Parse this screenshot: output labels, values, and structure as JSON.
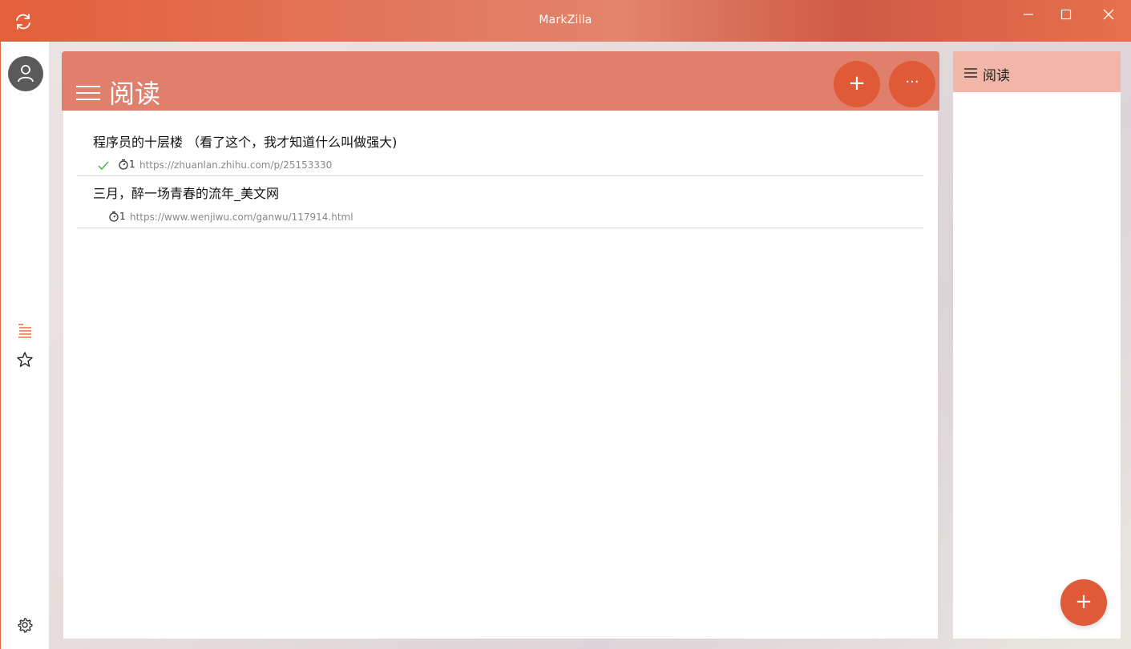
{
  "window": {
    "title": "MarkZilla"
  },
  "sidebar": {
    "items": [
      {
        "icon": "list-icon",
        "active": true
      },
      {
        "icon": "star-icon",
        "active": false
      }
    ],
    "settings_icon": "gear-icon"
  },
  "main": {
    "title": "阅读",
    "add_label": "+",
    "more_label": "···",
    "items": [
      {
        "title": "程序员的十层楼 （看了这个，我才知道什么叫做强大)",
        "done": true,
        "count": "1",
        "url": "https://zhuanlan.zhihu.com/p/25153330"
      },
      {
        "title": "三月，醉一场青春的流年_美文网",
        "done": false,
        "count": "1",
        "url": "https://www.wenjiwu.com/ganwu/117914.html"
      }
    ]
  },
  "right_panel": {
    "title": "阅读",
    "add_label": "+"
  },
  "colors": {
    "accent": "#e15a38",
    "header": "#e0806c",
    "right_header": "#f1b6a8",
    "check": "#4caf50"
  }
}
